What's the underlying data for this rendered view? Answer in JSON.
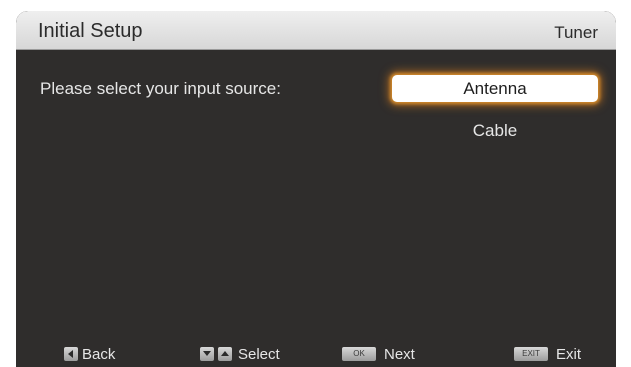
{
  "header": {
    "title": "Initial Setup",
    "section": "Tuner"
  },
  "main": {
    "prompt": "Please select your input source:",
    "options": [
      {
        "label": "Antenna",
        "selected": true
      },
      {
        "label": "Cable",
        "selected": false
      }
    ]
  },
  "footer": {
    "back": {
      "label": "Back",
      "icon": "left-arrow-key-icon"
    },
    "select": {
      "label": "Select",
      "icons": [
        "down-arrow-key-icon",
        "up-arrow-key-icon"
      ]
    },
    "next": {
      "label": "Next",
      "key_text": "OK",
      "icon": "ok-key-icon"
    },
    "exit": {
      "label": "Exit",
      "key_text": "EXIT",
      "icon": "exit-key-icon"
    }
  },
  "colors": {
    "background": "#2f2d2c",
    "header": "#e3e3e3",
    "highlight_glow": "#d38a2b",
    "text": "#e6e6e6"
  }
}
